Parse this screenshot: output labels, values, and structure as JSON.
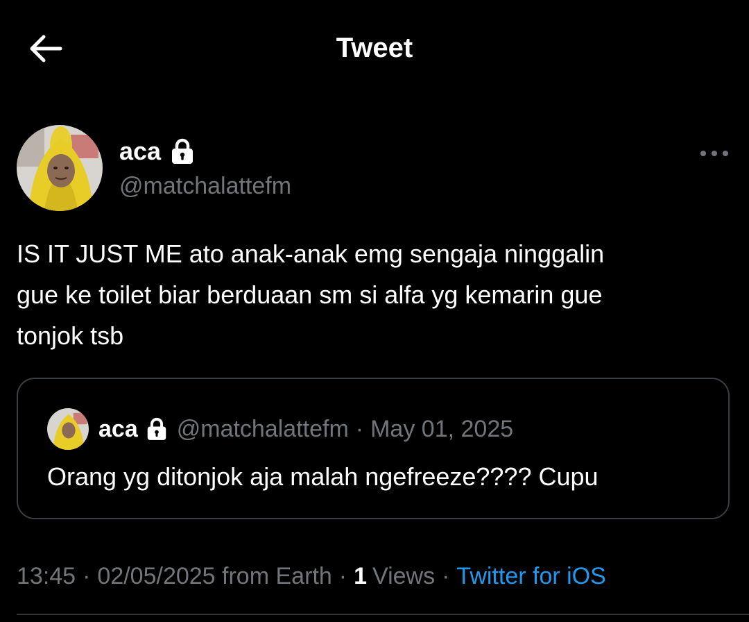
{
  "header": {
    "title": "Tweet",
    "back_icon": "arrow-left-icon"
  },
  "author": {
    "name": "aca",
    "handle": "@matchalattefm",
    "protected_icon": "lock-icon",
    "more_icon": "more-horizontal-icon"
  },
  "tweet": {
    "text": "IS IT JUST ME ato anak-anak emg sengaja ninggalin\ngue ke toilet biar berduaan sm si alfa yg kemarin gue\ntonjok tsb"
  },
  "quote": {
    "name": "aca",
    "handle": "@matchalattefm",
    "separator": "·",
    "date": "May 01, 2025",
    "text": "Orang yg ditonjok aja malah ngefreeze???? Cupu"
  },
  "meta": {
    "time": "13:45",
    "separator": "·",
    "date_from": "02/05/2025 from Earth",
    "views_count": "1",
    "views_label": "Views",
    "source": "Twitter for iOS"
  },
  "colors": {
    "background": "#000000",
    "text_primary": "#ffffff",
    "text_secondary": "#71767b",
    "link": "#1d9bf0",
    "border": "#3a3f44"
  }
}
